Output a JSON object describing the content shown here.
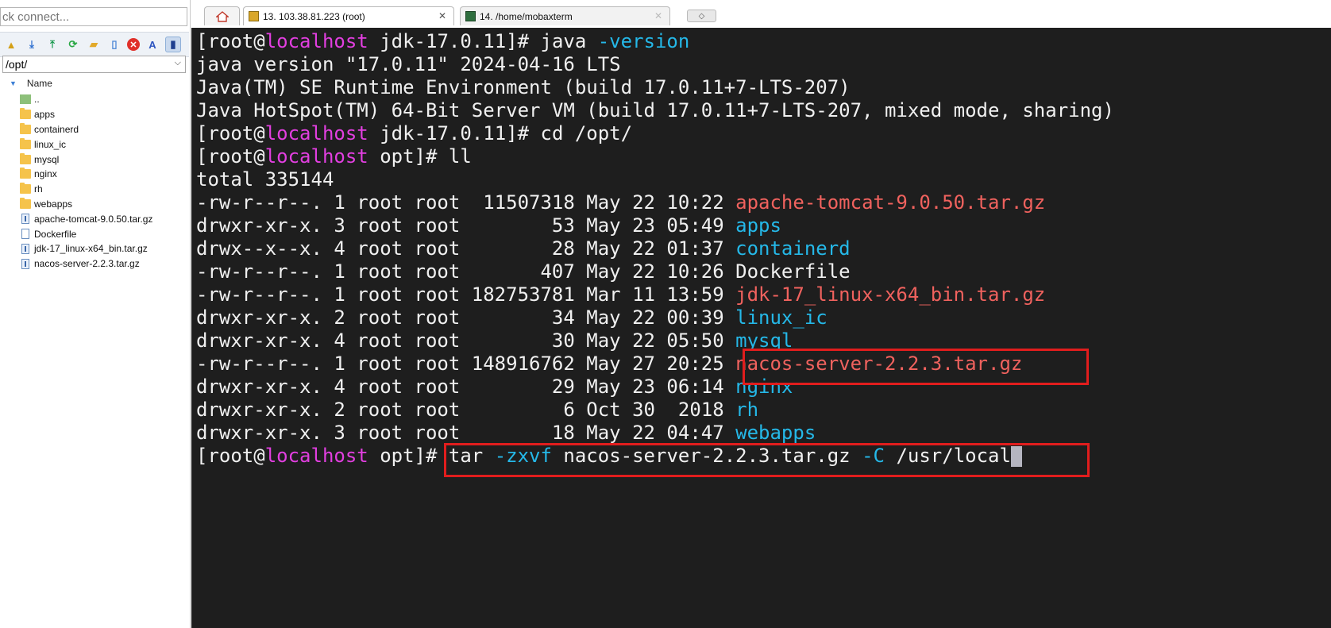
{
  "sidebar": {
    "quick_connect_placeholder": "ck connect...",
    "toolbar_icons": [
      "folder-up-icon",
      "download-icon",
      "upload-icon",
      "refresh-icon",
      "new-folder-icon",
      "new-file-icon",
      "delete-icon",
      "rename-icon",
      "sidebar-toggle-icon"
    ],
    "path": "/opt/",
    "column_name": "Name",
    "files": [
      {
        "name": "..",
        "kind": "up"
      },
      {
        "name": "apps",
        "kind": "folder"
      },
      {
        "name": "containerd",
        "kind": "folder"
      },
      {
        "name": "linux_ic",
        "kind": "folder"
      },
      {
        "name": "mysql",
        "kind": "folder"
      },
      {
        "name": "nginx",
        "kind": "folder"
      },
      {
        "name": "rh",
        "kind": "folder"
      },
      {
        "name": "webapps",
        "kind": "folder"
      },
      {
        "name": "apache-tomcat-9.0.50.tar.gz",
        "kind": "archive"
      },
      {
        "name": "Dockerfile",
        "kind": "file"
      },
      {
        "name": "jdk-17_linux-x64_bin.tar.gz",
        "kind": "archive"
      },
      {
        "name": "nacos-server-2.2.3.tar.gz",
        "kind": "archive"
      }
    ]
  },
  "tabs": {
    "home_icon": "home-icon",
    "tab13_label": "13. 103.38.81.223 (root)",
    "tab14_label": "14. /home/mobaxterm",
    "close_glyph": "✕",
    "new_tab_glyph": "◇"
  },
  "terminal": {
    "colors": {
      "magenta": "#e23fe0",
      "cyan": "#25b8e8",
      "red": "#f0625e",
      "white": "#f0f0f0",
      "background": "#1e1e1e",
      "highlight": "#e11d1d"
    },
    "lines": [
      [
        {
          "t": "[root@",
          "c": "white"
        },
        {
          "t": "localhost",
          "c": "magenta"
        },
        {
          "t": " jdk-17.0.11]# java ",
          "c": "white"
        },
        {
          "t": "-version",
          "c": "cyan"
        }
      ],
      [
        {
          "t": "java version \"17.0.11\" 2024-04-16 LTS",
          "c": "white"
        }
      ],
      [
        {
          "t": "Java(TM) SE Runtime Environment (build 17.0.11+7-LTS-207)",
          "c": "white"
        }
      ],
      [
        {
          "t": "Java HotSpot(TM) 64-Bit Server VM (build 17.0.11+7-LTS-207, mixed mode, sharing)",
          "c": "white"
        }
      ],
      [
        {
          "t": "[root@",
          "c": "white"
        },
        {
          "t": "localhost",
          "c": "magenta"
        },
        {
          "t": " jdk-17.0.11]# cd /opt/",
          "c": "white"
        }
      ],
      [
        {
          "t": "[root@",
          "c": "white"
        },
        {
          "t": "localhost",
          "c": "magenta"
        },
        {
          "t": " opt]# ll",
          "c": "white"
        }
      ],
      [
        {
          "t": "total 335144",
          "c": "white"
        }
      ],
      [
        {
          "t": "-rw-r--r--. 1 root root  11507318 May 22 10:22 ",
          "c": "white"
        },
        {
          "t": "apache-tomcat-9.0.50.tar.gz",
          "c": "red"
        }
      ],
      [
        {
          "t": "drwxr-xr-x. 3 root root        53 May 23 05:49 ",
          "c": "white"
        },
        {
          "t": "apps",
          "c": "cyan"
        }
      ],
      [
        {
          "t": "drwx--x--x. 4 root root        28 May 22 01:37 ",
          "c": "white"
        },
        {
          "t": "containerd",
          "c": "cyan"
        }
      ],
      [
        {
          "t": "-rw-r--r--. 1 root root       407 May 22 10:26 Dockerfile",
          "c": "white"
        }
      ],
      [
        {
          "t": "-rw-r--r--. 1 root root 182753781 Mar 11 13:59 ",
          "c": "white"
        },
        {
          "t": "jdk-17_linux-x64_bin.tar.gz",
          "c": "red"
        }
      ],
      [
        {
          "t": "drwxr-xr-x. 2 root root        34 May 22 00:39 ",
          "c": "white"
        },
        {
          "t": "linux_ic",
          "c": "cyan"
        }
      ],
      [
        {
          "t": "drwxr-xr-x. 4 root root        30 May 22 05:50 ",
          "c": "white"
        },
        {
          "t": "mysql",
          "c": "cyan"
        }
      ],
      [
        {
          "t": "-rw-r--r--. 1 root root 148916762 May 27 20:25 ",
          "c": "white"
        },
        {
          "t": "nacos-server-2.2.3.tar.gz",
          "c": "red"
        }
      ],
      [
        {
          "t": "drwxr-xr-x. 4 root root        29 May 23 06:14 ",
          "c": "white"
        },
        {
          "t": "nginx",
          "c": "cyan"
        }
      ],
      [
        {
          "t": "drwxr-xr-x. 2 root root         6 Oct 30  2018 ",
          "c": "white"
        },
        {
          "t": "rh",
          "c": "cyan"
        }
      ],
      [
        {
          "t": "drwxr-xr-x. 3 root root        18 May 22 04:47 ",
          "c": "white"
        },
        {
          "t": "webapps",
          "c": "cyan"
        }
      ],
      [
        {
          "t": "[root@",
          "c": "white"
        },
        {
          "t": "localhost",
          "c": "magenta"
        },
        {
          "t": " opt]# tar ",
          "c": "white"
        },
        {
          "t": "-zxvf",
          "c": "cyan"
        },
        {
          "t": " nacos-server-2.2.3.tar.gz ",
          "c": "white"
        },
        {
          "t": "-C",
          "c": "cyan"
        },
        {
          "t": " /usr/local",
          "c": "white"
        }
      ]
    ]
  }
}
